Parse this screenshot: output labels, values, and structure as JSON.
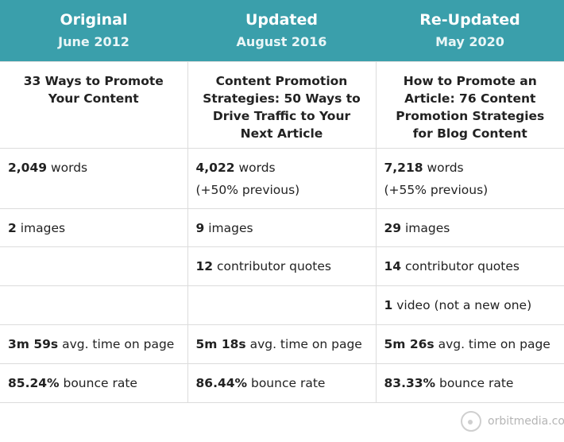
{
  "columns": [
    {
      "name": "Original",
      "date": "June 2012"
    },
    {
      "name": "Updated",
      "date": "August 2016"
    },
    {
      "name": "Re-Updated",
      "date": "May 2020"
    }
  ],
  "article_titles": [
    "33 Ways to Promote Your Content",
    "Content Promotion Strategies: 50 Ways to Drive Traffic to Your Next Article",
    "How to Promote an Article: 76 Content Promotion Strategies for Blog Content"
  ],
  "rows": {
    "words": [
      {
        "value": "2,049",
        "label": " words",
        "note": ""
      },
      {
        "value": "4,022",
        "label": " words",
        "note": "(+50% previous)"
      },
      {
        "value": "7,218",
        "label": " words",
        "note": "(+55% previous)"
      }
    ],
    "images": [
      {
        "value": "2",
        "label": " images"
      },
      {
        "value": "9",
        "label": " images"
      },
      {
        "value": "29",
        "label": " images"
      }
    ],
    "quotes": [
      {
        "value": "",
        "label": ""
      },
      {
        "value": "12",
        "label": " contributor quotes"
      },
      {
        "value": "14",
        "label": " contributor quotes"
      }
    ],
    "video": [
      {
        "value": "",
        "label": ""
      },
      {
        "value": "",
        "label": ""
      },
      {
        "value": "1",
        "label": " video (not a new one)"
      }
    ],
    "time": [
      {
        "value": "3m 59s",
        "label": " avg. time on page"
      },
      {
        "value": "5m 18s",
        "label": " avg. time on page"
      },
      {
        "value": "5m 26s",
        "label": " avg. time on page"
      }
    ],
    "bounce": [
      {
        "value": "85.24%",
        "label": " bounce rate"
      },
      {
        "value": "86.44%",
        "label": " bounce rate"
      },
      {
        "value": "83.33%",
        "label": " bounce rate"
      }
    ]
  },
  "watermark": "orbitmedia.com",
  "colors": {
    "header_bg": "#3a9fab",
    "border": "#dcdcdc"
  }
}
